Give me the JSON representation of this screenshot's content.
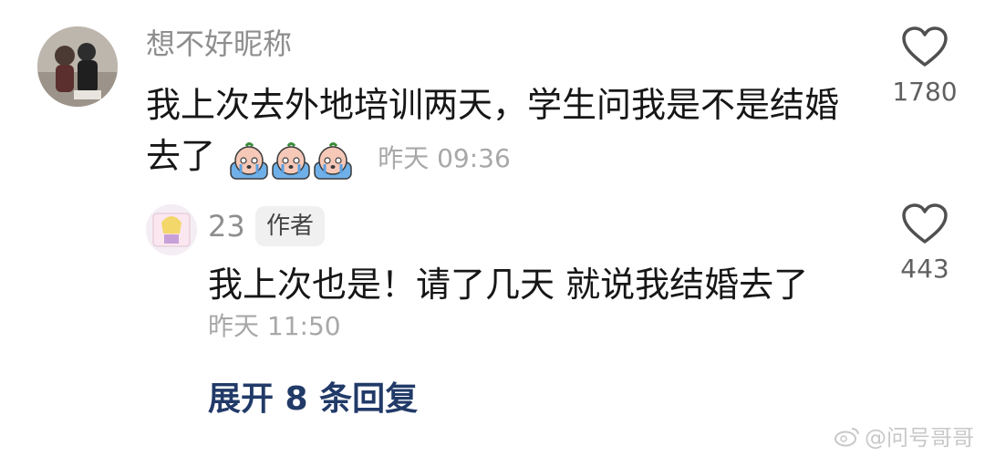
{
  "main_comment": {
    "username": "想不好昵称",
    "text": "我上次去外地培训两天，学生问我是不是结婚去了",
    "emoji_count": 3,
    "timestamp": "昨天 09:36",
    "likes": "1780"
  },
  "reply": {
    "username": "23",
    "badge": "作者",
    "text": "我上次也是！请了几天 就说我结婚去了",
    "timestamp": "昨天 11:50",
    "likes": "443"
  },
  "expand_replies": "展开 8 条回复",
  "watermark": "@问号哥哥",
  "colors": {
    "expand_link": "#213a68",
    "secondary_text": "#a8a8a8",
    "username": "#8e8e8e"
  },
  "icons": {
    "like": "heart-outline-icon",
    "emoji": "crying-peach-emoji",
    "watermark": "weibo-logo-icon"
  }
}
